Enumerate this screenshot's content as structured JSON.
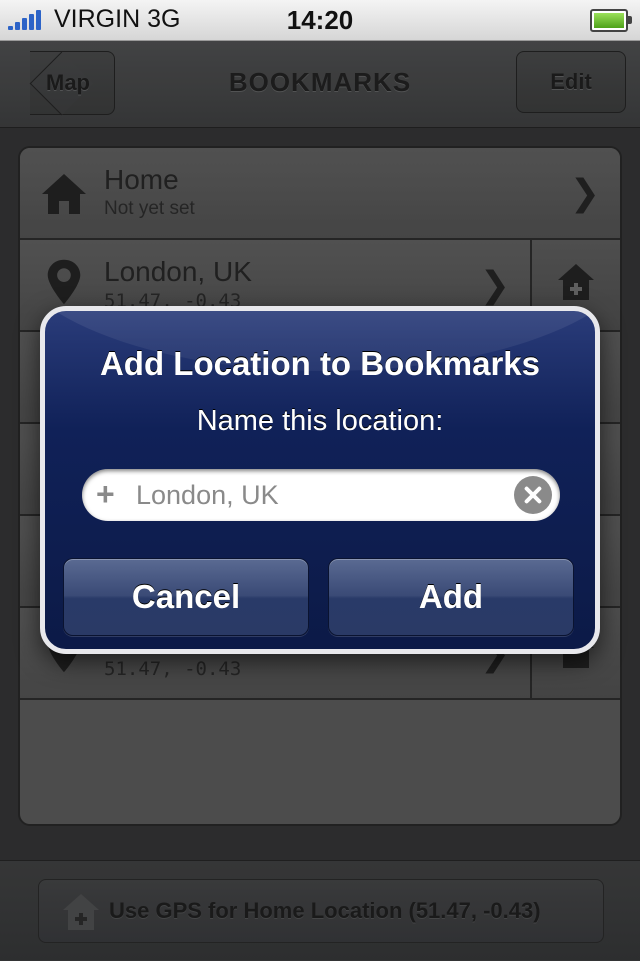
{
  "status_bar": {
    "carrier": "VIRGIN",
    "network": "3G",
    "time": "14:20"
  },
  "nav": {
    "title": "BOOKMARKS",
    "back_label": "Map",
    "edit_label": "Edit"
  },
  "list": {
    "rows": [
      {
        "title": "Home",
        "subtitle": "Not yet set",
        "icon": "home-icon"
      },
      {
        "title": "London, UK",
        "subtitle": "51.47, -0.43",
        "icon": "map-pin-icon",
        "action_icon": "add-home-icon"
      },
      {
        "title": "",
        "subtitle": "",
        "icon": ""
      },
      {
        "title": "",
        "subtitle": "",
        "icon": ""
      },
      {
        "title": "",
        "subtitle": "",
        "icon": ""
      },
      {
        "title": "",
        "subtitle": "51.47, -0.43",
        "icon": "map-pin-icon",
        "action_icon": "add-home-icon"
      }
    ]
  },
  "toolbar": {
    "gps_label": "Use GPS for Home Location (51.47, -0.43)",
    "gps_icon": "add-home-icon"
  },
  "alert": {
    "title": "Add Location to Bookmarks",
    "message": "Name this location:",
    "field_placeholder": "London, UK",
    "cancel_label": "Cancel",
    "add_label": "Add"
  },
  "colors": {
    "alert_bg": "#102158",
    "signal": "#2c63c7",
    "battery": "#6cc531"
  }
}
